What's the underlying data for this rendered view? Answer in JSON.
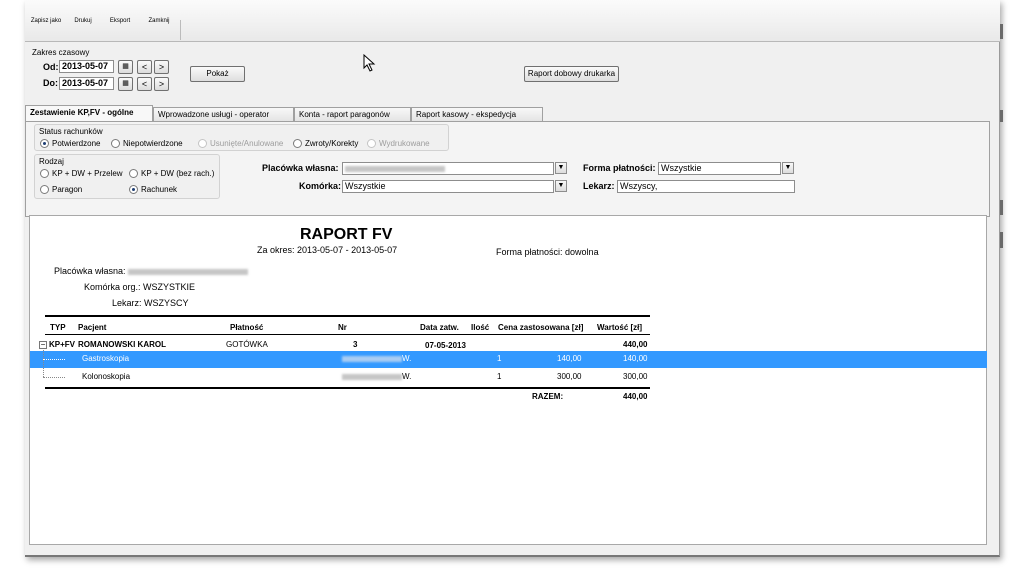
{
  "toolbar": {
    "buttons": [
      {
        "label": "Zapisz jako",
        "icon": "save-icon"
      },
      {
        "label": "Drukuj",
        "icon": "print-icon"
      },
      {
        "label": "Eksport",
        "icon": "export-icon"
      },
      {
        "label": "Zamknij",
        "icon": "close-icon"
      }
    ]
  },
  "date_range": {
    "title": "Zakres czasowy",
    "from_label": "Od:",
    "from_value": "2013-05-07",
    "to_label": "Do:",
    "to_value": "2013-05-07",
    "prev": "<",
    "next": ">"
  },
  "buttons": {
    "show": "Pokaż",
    "daily_report": "Raport dobowy drukarka"
  },
  "tabs": [
    {
      "label": "Zestawienie KP,FV - ogólne",
      "active": true
    },
    {
      "label": "Wprowadzone usługi - operator"
    },
    {
      "label": "Konta - raport paragonów"
    },
    {
      "label": "Raport kasowy - ekspedycja"
    }
  ],
  "status": {
    "title": "Status rachunków",
    "options": [
      {
        "label": "Potwierdzone",
        "checked": true,
        "enabled": true
      },
      {
        "label": "Niepotwierdzone",
        "checked": false,
        "enabled": true
      },
      {
        "label": "Usunięte/Anulowane",
        "checked": false,
        "enabled": false
      },
      {
        "label": "Zwroty/Korekty",
        "checked": false,
        "enabled": true
      },
      {
        "label": "Wydrukowane",
        "checked": false,
        "enabled": false
      }
    ]
  },
  "kind": {
    "title": "Rodzaj",
    "options": [
      {
        "label": "KP + DW + Przelew",
        "checked": false
      },
      {
        "label": "KP + DW (bez rach.)",
        "checked": false
      },
      {
        "label": "Paragon",
        "checked": false
      },
      {
        "label": "Rachunek",
        "checked": true
      }
    ]
  },
  "filters": {
    "placowka_label": "Placówka własna:",
    "komorka_label": "Komórka:",
    "komorka_value": "Wszystkie",
    "forma_label": "Forma płatności:",
    "forma_value": "Wszystkie",
    "lekarz_label": "Lekarz:",
    "lekarz_value": "Wszyscy,"
  },
  "report": {
    "title": "RAPORT FV",
    "period_label": "Za okres:",
    "period_value": "2013-05-07 - 2013-05-07",
    "payment_label": "Forma płatności:",
    "payment_value": "dowolna",
    "placowka_label": "Placówka własna:",
    "komorka_label": "Komórka org.:",
    "komorka_value": "WSZYSTKIE",
    "lekarz_label": "Lekarz:",
    "lekarz_value": "WSZYSCY",
    "columns": [
      "TYP",
      "Pacjent",
      "Płatność",
      "Nr",
      "Data zatw.",
      "Ilość",
      "Cena zastosowana [zł]",
      "Wartość [zł]"
    ],
    "group": {
      "expand": "−",
      "type": "KP+FV",
      "patient": "ROMANOWSKI KAROL",
      "payment": "GOTÓWKA",
      "nr": "3",
      "date": "07-05-2013",
      "value": "440,00"
    },
    "items": [
      {
        "name": "Gastroskopia",
        "nr_suffix": "W.",
        "qty": "1",
        "price": "140,00",
        "value": "140,00",
        "selected": true
      },
      {
        "name": "Kolonoskopia",
        "nr_suffix": "W.",
        "qty": "1",
        "price": "300,00",
        "value": "300,00",
        "selected": false
      }
    ],
    "total_label": "RAZEM:",
    "total_value": "440,00"
  },
  "colors": {
    "selection": "#3399ff",
    "border": "#a8a8a8"
  }
}
